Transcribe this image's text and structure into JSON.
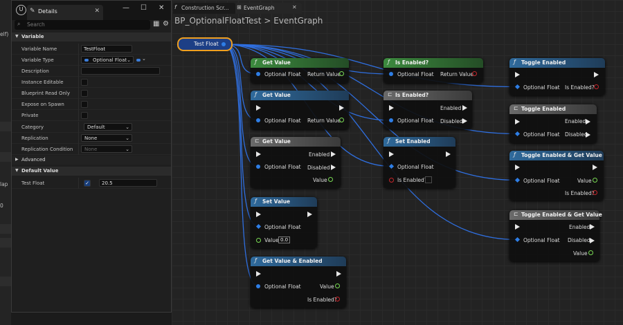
{
  "left_strip": {
    "fragments": [
      "elf)",
      "lap",
      "0"
    ]
  },
  "details": {
    "tab_label": "Details",
    "window_buttons": {
      "minimize": "—",
      "maximize": "☐",
      "close": "✕"
    },
    "search_placeholder": "Search",
    "sections": {
      "variable": "Variable",
      "advanced": "Advanced",
      "default_value": "Default Value"
    },
    "props": {
      "variable_name": {
        "label": "Variable Name",
        "value": "TestFloat"
      },
      "variable_type": {
        "label": "Variable Type",
        "value": "Optional Float"
      },
      "description": {
        "label": "Description",
        "value": ""
      },
      "instance_editable": {
        "label": "Instance Editable",
        "checked": false
      },
      "blueprint_read_only": {
        "label": "Blueprint Read Only",
        "checked": false
      },
      "expose_on_spawn": {
        "label": "Expose on Spawn",
        "checked": false
      },
      "private": {
        "label": "Private",
        "checked": false
      },
      "category": {
        "label": "Category",
        "value": "Default"
      },
      "replication": {
        "label": "Replication",
        "value": "None"
      },
      "replication_condition": {
        "label": "Replication Condition",
        "value": "None"
      },
      "test_float": {
        "label": "Test Float",
        "checked": true,
        "value": "20.5"
      }
    }
  },
  "graph": {
    "tabs": [
      {
        "label": "Construction Scr..."
      },
      {
        "label": "EventGraph"
      }
    ],
    "breadcrumb": {
      "blueprint": "BP_OptionalFloatTest",
      "separator": ">",
      "graph": "EventGraph"
    },
    "colors": {
      "pure_header": "#2d7a36",
      "call_header": "#2a5f8c",
      "grey_header": "#5a5a5a",
      "wire": "#2f6fe0",
      "bool_pin": "#c6262b",
      "float_pin": "#7bdc55"
    },
    "variable_node": {
      "label": "Test Float"
    },
    "nodes": {
      "getvalue_pure": {
        "title": "Get Value",
        "in": "Optional Float",
        "out": "Return Value"
      },
      "getvalue_exec": {
        "title": "Get Value",
        "in": "Optional Float",
        "out": "Return Value"
      },
      "getvalue_grey": {
        "title": "Get Value",
        "in": "Optional Float",
        "out1": "Enabled",
        "out2": "Disabled",
        "out3": "Value"
      },
      "setvalue": {
        "title": "Set Value",
        "in": "Optional Float",
        "value_label": "Value",
        "value": "0.0"
      },
      "getvalue_enabled": {
        "title": "Get Value & Enabled",
        "in": "Optional Float",
        "out1": "Value",
        "out2": "Is Enabled?"
      },
      "isenabled_pure": {
        "title": "Is Enabled?",
        "in": "Optional Float",
        "out": "Return Value"
      },
      "isenabled_grey": {
        "title": "Is Enabled?",
        "in": "Optional Float",
        "out1": "Enabled",
        "out2": "Disabled"
      },
      "setenabled": {
        "title": "Set Enabled",
        "in": "Optional Float",
        "in2": "Is Enabled?"
      },
      "toggle_call": {
        "title": "Toggle Enabled",
        "in": "Optional Float",
        "out": "Is Enabled?"
      },
      "toggle_grey": {
        "title": "Toggle Enabled",
        "in": "Optional Float",
        "out1": "Enabled",
        "out2": "Disabled"
      },
      "toggle_get": {
        "title": "Toggle Enabled & Get Value",
        "in": "Optional Float",
        "out1": "Value",
        "out2": "Is Enabled?"
      },
      "toggle_get_grey": {
        "title": "Toggle Enabled & Get Value",
        "in": "Optional Float",
        "out1": "Enabled",
        "out2": "Disabled",
        "out3": "Value"
      }
    }
  }
}
